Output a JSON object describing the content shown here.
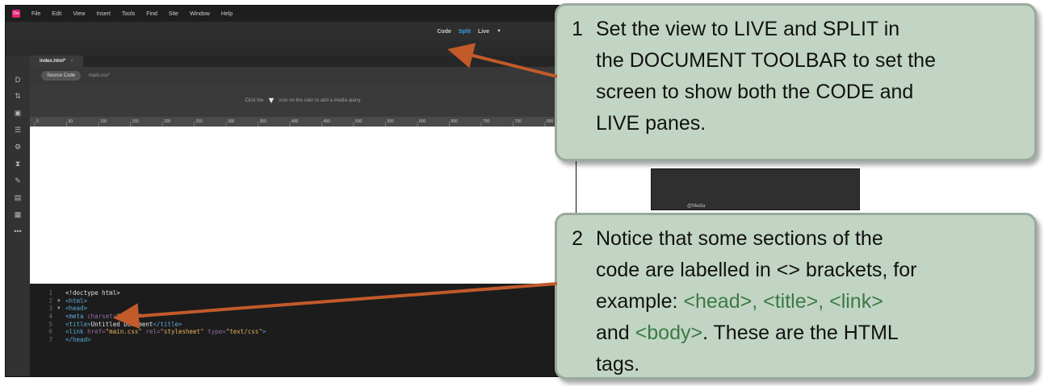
{
  "menubar": {
    "logo": "Dw",
    "items": [
      "File",
      "Edit",
      "View",
      "Insert",
      "Tools",
      "Find",
      "Site",
      "Window",
      "Help"
    ]
  },
  "doc_toolbar": {
    "code": "Code",
    "split": "Split",
    "live": "Live",
    "caret": "▼"
  },
  "tabs": {
    "file": "index.html*",
    "close": "×"
  },
  "related_files": {
    "source_code": "Source Code",
    "css": "main.css*"
  },
  "media_query": {
    "prefix": "Click the",
    "icon": "▼",
    "suffix": "icon on the ruler to add a media query"
  },
  "ruler": {
    "ticks": [
      "0",
      "50",
      "100",
      "150",
      "200",
      "250",
      "300",
      "350",
      "400",
      "450",
      "500",
      "550",
      "600",
      "650",
      "700",
      "750",
      "800"
    ]
  },
  "left_tools": [
    "D",
    "⇅",
    "▣",
    "☰",
    "⚙",
    "⧗",
    "✎",
    "▤",
    "▦",
    "•••"
  ],
  "code_lines": [
    {
      "n": "1",
      "fold": "",
      "parts": [
        [
          "txt",
          "<!doctype html>"
        ]
      ]
    },
    {
      "n": "2",
      "fold": "▼",
      "parts": [
        [
          "tag",
          "<html>"
        ]
      ]
    },
    {
      "n": "3",
      "fold": "▼",
      "parts": [
        [
          "tag",
          "<head>"
        ]
      ]
    },
    {
      "n": "4",
      "fold": "",
      "parts": [
        [
          "tag",
          "<meta "
        ],
        [
          "attr",
          "charset="
        ],
        [
          "str",
          "\"utf-8\""
        ],
        [
          "tag",
          ">"
        ]
      ]
    },
    {
      "n": "5",
      "fold": "",
      "parts": [
        [
          "tag",
          "<title>"
        ],
        [
          "txt",
          "Untitled Document"
        ],
        [
          "tag",
          "</title>"
        ]
      ]
    },
    {
      "n": "6",
      "fold": "",
      "parts": [
        [
          "tag",
          "<link "
        ],
        [
          "attr",
          "href="
        ],
        [
          "str",
          "\"main.css\" "
        ],
        [
          "attr",
          "rel="
        ],
        [
          "str",
          "\"stylesheet\" "
        ],
        [
          "attr",
          "type="
        ],
        [
          "str",
          "\"text/css\""
        ],
        [
          "tag",
          ">"
        ]
      ]
    },
    {
      "n": "7",
      "fold": "",
      "parts": [
        [
          "tag",
          "</head>"
        ]
      ]
    }
  ],
  "panel": {
    "label": "@Media"
  },
  "callout1": {
    "number": "1",
    "lines": [
      "Set the view to LIVE and SPLIT in",
      "the DOCUMENT TOOLBAR to set the",
      "screen to show both the CODE and",
      "LIVE panes."
    ]
  },
  "callout2": {
    "number": "2",
    "line1": "Notice that some sections of the",
    "line2": "code are labelled in <> brackets, for",
    "line3_prefix": "example: ",
    "line3_tags": "<head>, <title>, <link>",
    "line4_prefix": "and ",
    "line4_tag": "<body>",
    "line4_suffix": ". These are the HTML",
    "line5": "tags."
  },
  "colors": {
    "callout_bg": "#c2d5c4",
    "arrow": "#c25a2a",
    "tag_green": "#3c7a45",
    "split_active": "#3aa0e0"
  }
}
